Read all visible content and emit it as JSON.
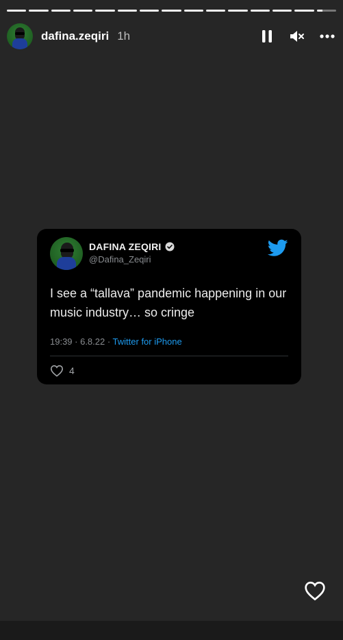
{
  "story": {
    "segments_total": 15,
    "segments_complete": 14,
    "current_segment_progress": 0.3
  },
  "header": {
    "username": "dafina.zeqiri",
    "time": "1h",
    "icons": [
      "pause-icon",
      "mute-icon",
      "more-icon"
    ]
  },
  "tweet": {
    "display_name": "DAFINA ZEQIRI",
    "handle": "@Dafina_Zeqiri",
    "text": "I see a “tallava” pandemic happening in our music industry… so cringe",
    "meta": "19:39 · 6.8.22 · ",
    "source": "Twitter for iPhone",
    "likes": "4"
  },
  "colors": {
    "background": "#262626",
    "tweet_card": "#000000",
    "twitter_blue": "#1d9bf0",
    "avatar_green": "#2f7d33"
  }
}
